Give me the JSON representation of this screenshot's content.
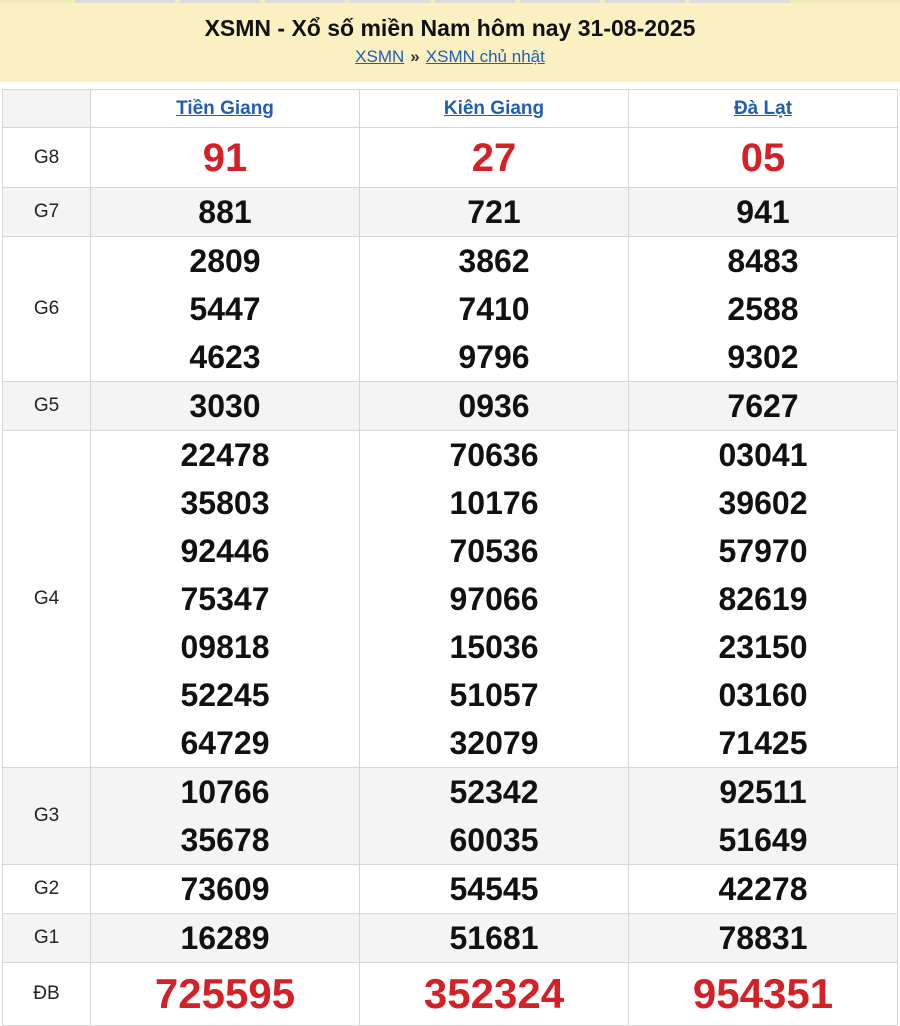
{
  "header": {
    "title": "XSMN - Xổ số miền Nam hôm nay 31-08-2025",
    "breadcrumb": {
      "link1": "XSMN",
      "separator": "»",
      "link2": "XSMN chủ nhật"
    }
  },
  "provinces": [
    "Tiền Giang",
    "Kiên Giang",
    "Đà Lạt"
  ],
  "prizes": {
    "g8": {
      "label": "G8",
      "values": [
        "91",
        "27",
        "05"
      ]
    },
    "g7": {
      "label": "G7",
      "values": [
        "881",
        "721",
        "941"
      ]
    },
    "g6": {
      "label": "G6",
      "values": [
        [
          "2809",
          "5447",
          "4623"
        ],
        [
          "3862",
          "7410",
          "9796"
        ],
        [
          "8483",
          "2588",
          "9302"
        ]
      ]
    },
    "g5": {
      "label": "G5",
      "values": [
        "3030",
        "0936",
        "7627"
      ]
    },
    "g4": {
      "label": "G4",
      "values": [
        [
          "22478",
          "35803",
          "92446",
          "75347",
          "09818",
          "52245",
          "64729"
        ],
        [
          "70636",
          "10176",
          "70536",
          "97066",
          "15036",
          "51057",
          "32079"
        ],
        [
          "03041",
          "39602",
          "57970",
          "82619",
          "23150",
          "03160",
          "71425"
        ]
      ]
    },
    "g3": {
      "label": "G3",
      "values": [
        [
          "10766",
          "35678"
        ],
        [
          "52342",
          "60035"
        ],
        [
          "92511",
          "51649"
        ]
      ]
    },
    "g2": {
      "label": "G2",
      "values": [
        "73609",
        "54545",
        "42278"
      ]
    },
    "g1": {
      "label": "G1",
      "values": [
        "16289",
        "51681",
        "78831"
      ]
    },
    "db": {
      "label": "ĐB",
      "values": [
        "725595",
        "352324",
        "954351"
      ]
    }
  },
  "colors": {
    "header_bg": "#fbf0c2",
    "link": "#1f5fb3",
    "highlight": "#d42027",
    "row_alt": "#f4f4f4"
  }
}
